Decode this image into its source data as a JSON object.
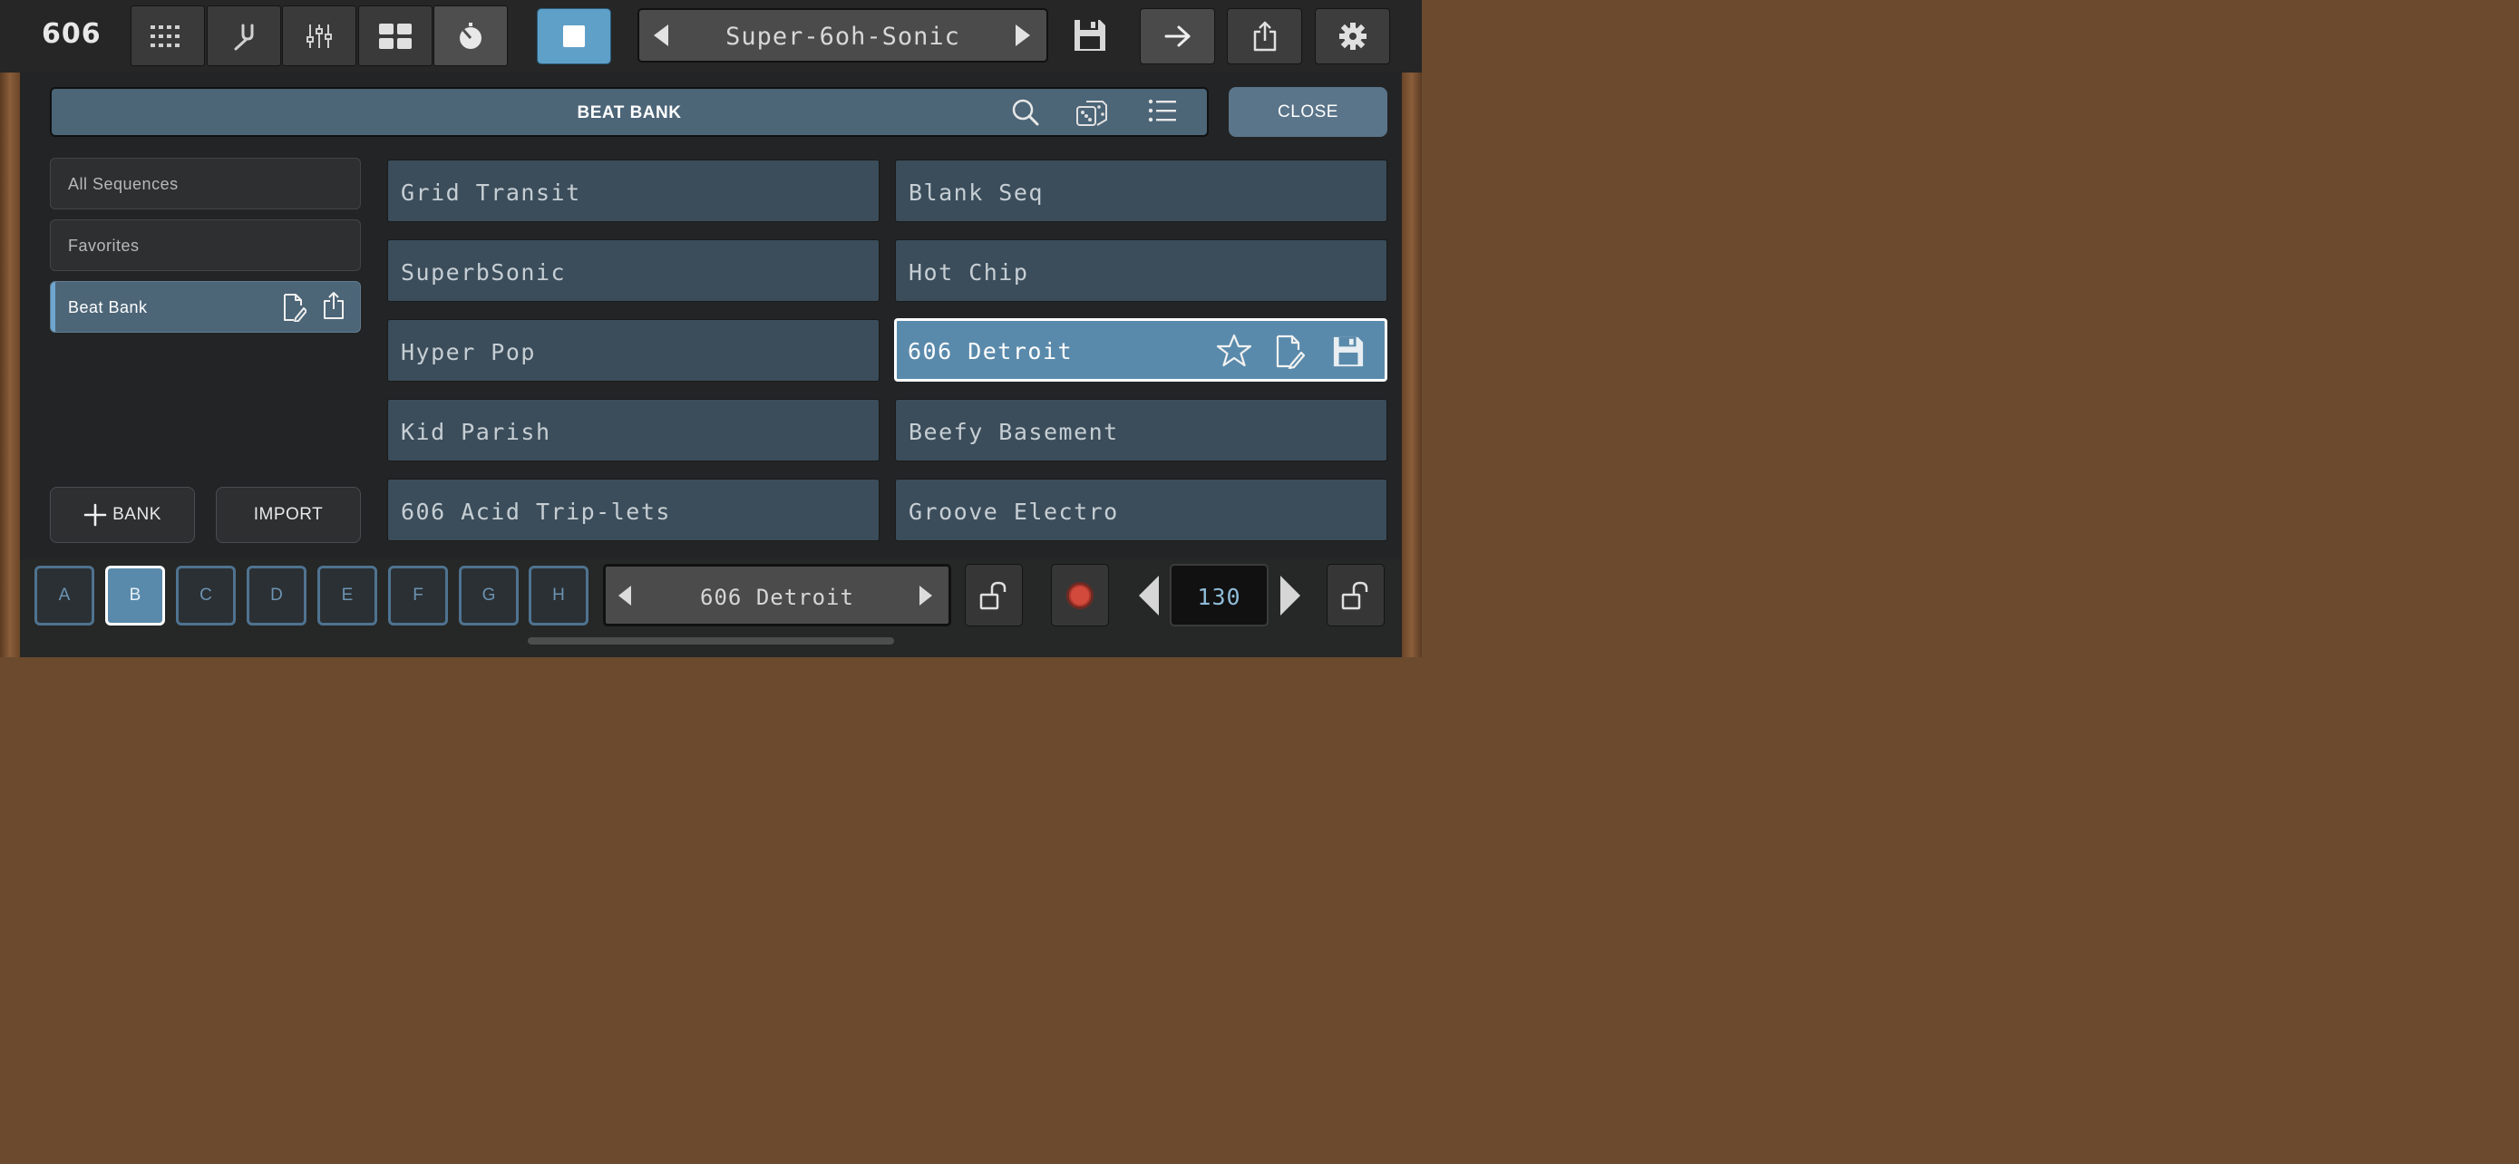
{
  "app": {
    "logo": "606"
  },
  "toolbar": {
    "preset_name": "Super-6oh-Sonic",
    "colors": {
      "accent": "#5fa0c8",
      "panel": "#4c6577"
    },
    "icons": [
      "step-grid-icon",
      "tuning-fork-icon",
      "mixer-sliders-icon",
      "layout-grid-icon",
      "knob-icon",
      "stop-icon",
      "save-disk-icon",
      "arrow-right-icon",
      "share-icon",
      "gear-icon"
    ]
  },
  "header": {
    "title": "BEAT BANK",
    "close_label": "CLOSE"
  },
  "sidebar": {
    "items": [
      {
        "label": "All Sequences"
      },
      {
        "label": "Favorites"
      },
      {
        "label": "Beat Bank"
      }
    ],
    "add_bank_label": "BANK",
    "import_label": "IMPORT"
  },
  "sequences": [
    {
      "name": "Grid Transit"
    },
    {
      "name": "Blank Seq"
    },
    {
      "name": "SuperbSonic"
    },
    {
      "name": "Hot Chip"
    },
    {
      "name": "Hyper Pop"
    },
    {
      "name": "606 Detroit"
    },
    {
      "name": "Kid Parish"
    },
    {
      "name": "Beefy Basement"
    },
    {
      "name": "606 Acid Trip-lets"
    },
    {
      "name": "Groove Electro"
    }
  ],
  "bottom": {
    "patterns": [
      "A",
      "B",
      "C",
      "D",
      "E",
      "F",
      "G",
      "H"
    ],
    "selected_pattern": "B",
    "pattern_name": "606 Detroit",
    "tempo": "130"
  }
}
